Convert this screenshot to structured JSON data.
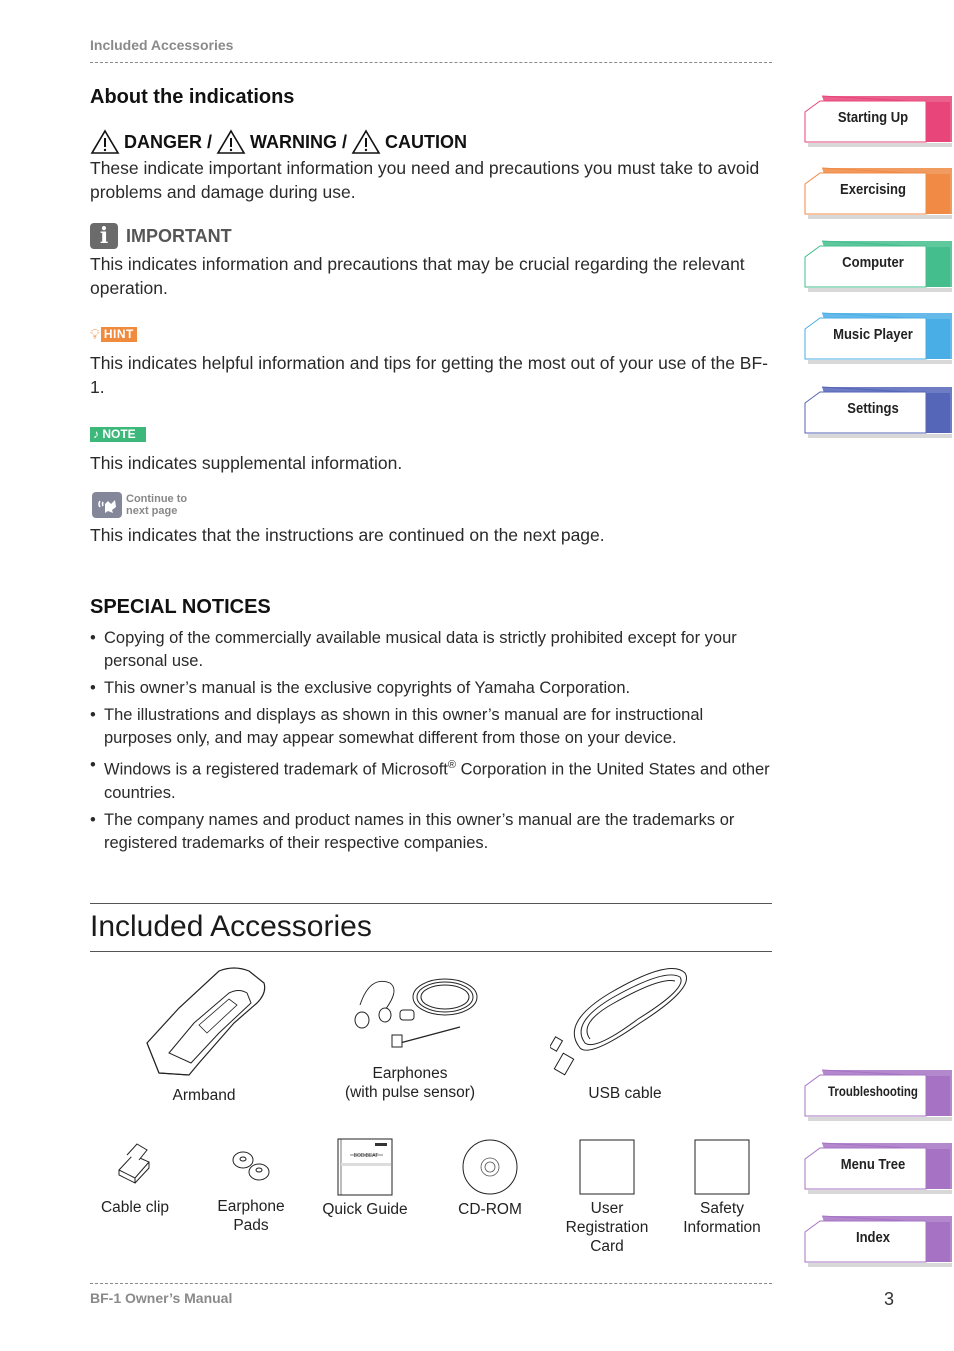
{
  "header": {
    "running_title": "Included Accessories"
  },
  "indications": {
    "title": "About the indications",
    "warning": {
      "labels": [
        "DANGER /",
        "WARNING /",
        "CAUTION"
      ],
      "text": "These indicate important information you need and precautions you must take to avoid problems and damage during use."
    },
    "important": {
      "label": "IMPORTANT",
      "icon_glyph": "i",
      "text": "This indicates information and precautions that may be crucial regarding the relevant operation."
    },
    "hint": {
      "label": "HINT",
      "color": "#f08a3c",
      "text": "This indicates helpful information and tips for getting the most out of your use of the BF-1."
    },
    "note": {
      "label": "♪ NOTE",
      "color": "#3cb87a",
      "text": "This indicates supplemental information."
    },
    "continue": {
      "label_line1": "Continue to",
      "label_line2": "next page",
      "text": "This indicates that the instructions are continued on the next page."
    }
  },
  "special_notices": {
    "title": "SPECIAL NOTICES",
    "items": [
      "Copying of the commercially available musical data is strictly prohibited except for your personal use.",
      "This owner’s manual is the exclusive copyrights of Yamaha Corporation.",
      "The illustrations and displays as shown in this owner’s manual are for instructional purposes only, and may appear somewhat different from those on your device.",
      {
        "before": "Windows is a registered trademark of Microsoft",
        "sup": "®",
        "after": " Corporation in the United States and other countries."
      },
      "The company names and product names in this owner’s manual are the trademarks or registered trademarks of their respective companies."
    ]
  },
  "accessories": {
    "title": "Included Accessories",
    "items": [
      {
        "label_lines": [
          "Armband"
        ]
      },
      {
        "label_lines": [
          "Earphones",
          "(with pulse sensor)"
        ]
      },
      {
        "label_lines": [
          "USB cable"
        ]
      },
      {
        "label_lines": [
          "Cable clip"
        ]
      },
      {
        "label_lines": [
          "Earphone",
          "Pads"
        ]
      },
      {
        "label_lines": [
          "Quick Guide"
        ]
      },
      {
        "label_lines": [
          "CD-ROM"
        ]
      },
      {
        "label_lines": [
          "User",
          "Registration",
          "Card"
        ]
      },
      {
        "label_lines": [
          "Safety",
          "Information"
        ]
      }
    ]
  },
  "side_tabs": [
    {
      "label": "Starting Up",
      "color": "#e8457a"
    },
    {
      "label": "Exercising",
      "color": "#f08a45"
    },
    {
      "label": "Computer",
      "color": "#43be8c"
    },
    {
      "label": "Music Player",
      "color": "#4aaee6"
    },
    {
      "label": "Settings",
      "color": "#5565b8"
    },
    {
      "label": "Troubleshooting",
      "color": "#a673c4"
    },
    {
      "label": "Menu Tree",
      "color": "#a673c4"
    },
    {
      "label": "Index",
      "color": "#a673c4"
    }
  ],
  "footer": {
    "manual_title": "BF-1 Owner’s Manual",
    "page_number": "3"
  }
}
